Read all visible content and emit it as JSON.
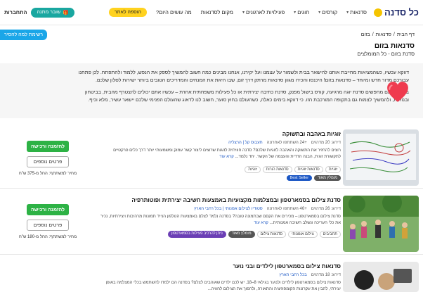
{
  "nav": {
    "logo": "כל סדנה",
    "items": [
      {
        "label": "סדנאות",
        "chevron": true
      },
      {
        "label": "קורסים",
        "chevron": true
      },
      {
        "label": "חוגים",
        "chevron": true
      },
      {
        "label": "פעילויות לארגונים",
        "chevron": true
      },
      {
        "label": "מקום לסדנאות",
        "chevron": false
      },
      {
        "label": "מה עושים היום?",
        "chevron": false
      }
    ],
    "add_business": "הוספה לאתר",
    "gift": "שובר מתנה",
    "login": "התחברות"
  },
  "side_cta": "רשימת למה להסיר",
  "breadcrumb": [
    "דף הבית",
    "סדנאות",
    "בזום"
  ],
  "page_title": "סדנאות בזום",
  "page_subtitle": "סדנת בזום - כל המומלצים",
  "intro": {
    "p1": "דווקא עכשיו, כשהמציאות מחייבת אותנו להישאר בבית ולשמור על עצמנו ועל יקירנו, אנחנו מבינים כמה חשוב להמשיך לספק את הנפש, ללמוד ולהתפתח. לכן פתחנו עבורכם מדור חדש ומיוחד – סדנאות בזום! היכנסו והכירו מגוון סדנאות מרתק דרך זום, שבו היאת את המנחים והמדריכים הטובים ביותר ישירות לסלון שלכם.",
    "p2": "בין אם אתם מחפשים סדנת יוגה מרגיעה, קורס בישול מפנק, סדנת כתיבה יצירתית או כל פעילות משפחתית אחרת – עכשיו אתם יכולים להצטרף מהבית, בביטחון ובנוחות, ולהמשיך לצמוח גם בתקופה המורכבת הזו. כי דווקא בימים כאלה, כשהעולם בחוץ סוער, חשוב לנו לדאוג שהעולם הפנימי שלכם יישאר עשיר, מלא וכיף."
  },
  "cards": [
    {
      "title": "זוגיות באהבה ובתשוקה",
      "rating": "דירוג: 20 מדרגים",
      "participants": "+24 השתתפו לאחרונה",
      "location": "תעבוס קל | הרצליה",
      "desc": "רוצים להחזיר את התשוקה והאהבה לזוגיות שלכם? סדנה חוויתית לזוגות שרוצים ליצור קשר עמוק ומשמעותי יותר דרך כלים פרקטיים לתקשורת זוגית, הבנה הדדית והעצמה של הקשר. יחד נלמד...",
      "more": "קרא עוד",
      "tags": [
        "זוגיות",
        "סדנאות זוגיות",
        "סדנאות הורות",
        "זוגיות"
      ],
      "badges": [
        "Best Seller",
        "מומלץ מאוד"
      ],
      "cta": "להזמנה ורכישה",
      "more_btn": "פרטים נוספים",
      "price": "מחיר למשתתף: החל מ-375 ש\"ח"
    },
    {
      "title": "סדנת צילום בסמארטפון ובמצלמות מקצועיות באמצעות חשיבה יצירתית ופוטותרפיה",
      "rating": "דירוג: 26 מדרגים",
      "participants": "+46 השתתפו לאחרונה",
      "location": "סטודיו לצילום אמנותי | בכל רחבי הארץ",
      "desc": "סדנת צילום בסמארטפון – מכירים את הקסם שבתמונה טובה? בסדנה נלמד לצלם באמצעות הטלפון הנייד תמונות מרהיבות ויצירתיות, נכיר את כלי העריכה ונשלב חשיבה אמנותית...",
      "more": "קרא עוד",
      "tags": [
        "תחביבים",
        "צילום אומנותי",
        "סדנאות צילום"
      ],
      "badges": [
        "מומלץ מאוד",
        "ניתן להרכיב פעילות בסמארטפון"
      ],
      "cta": "להזמנה ורכישה",
      "more_btn": "פרטים נוספים",
      "price": "מחיר למשתתף: החל מ-180 ש\"ח"
    },
    {
      "title": "סדנאות צילום בסמארטפון לילדים ובני נוער",
      "rating": "דירוג: 18 מדרגים",
      "participants": "",
      "location": "בכל רחבי הארץ",
      "desc": "סדנאות צילום בסמארטפון לילדים ולנוער בגילאי 8–18. יש לכם ילדים שאוהבים לצלם? בסדנה הם ילמדו להשתמש בכלי המצלמה באופן יצירתי, להבין את עקרונות הקומפוזיציה והתאורה, ולהפוך את הצילום לחוויה...",
      "more": "",
      "tags": [],
      "badges": [],
      "cta": "",
      "more_btn": "",
      "price": ""
    }
  ]
}
